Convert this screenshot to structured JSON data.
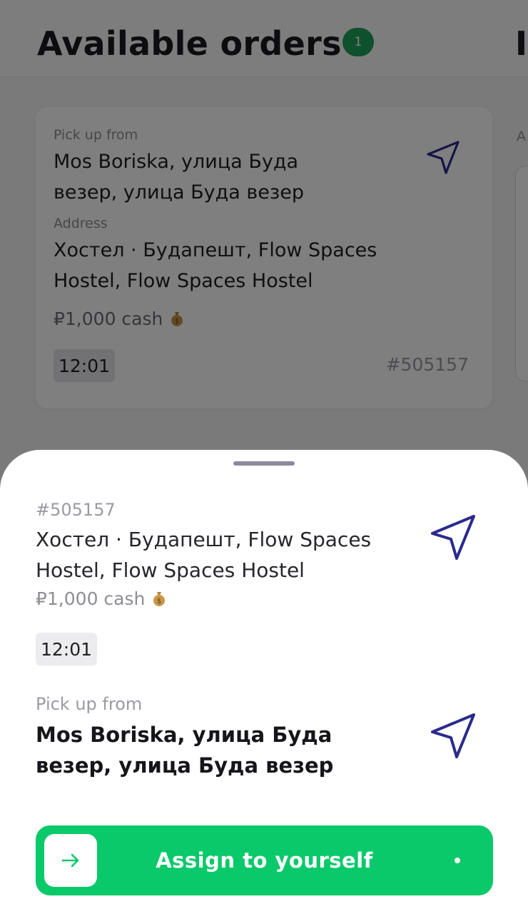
{
  "header": {
    "title": "Available orders",
    "badge_count": "1",
    "next_tab_fragment": "I"
  },
  "order_card": {
    "pickup_label": "Pick up from",
    "pickup_text": "Mos Boriska, улица Буда везер, улица Буда везер",
    "address_label": "Address",
    "address_text": "Хостел · Будапешт, Flow Spaces Hostel, Flow Spaces Hostel",
    "price": "₽1,000 cash",
    "time": "12:01",
    "order_id": "#505157"
  },
  "side_panel": {
    "label_fragment": "A"
  },
  "sheet": {
    "order_id": "#505157",
    "address_text": "Хостел · Будапешт, Flow Spaces Hostel, Flow Spaces Hostel",
    "price": "₽1,000 cash",
    "time": "12:01",
    "pickup_label": "Pick up from",
    "pickup_text": "Mos Boriska, улица Буда везер, улица Буда везер",
    "assign_label": "Assign to yourself"
  },
  "icons": {
    "navigation": "navigation-arrow-icon",
    "money": "money-bag-icon",
    "arrow": "arrow-right-icon"
  },
  "colors": {
    "accent_green": "#0ac96a",
    "badge_green": "#1fa05a",
    "nav_icon": "#2a2a8c"
  }
}
